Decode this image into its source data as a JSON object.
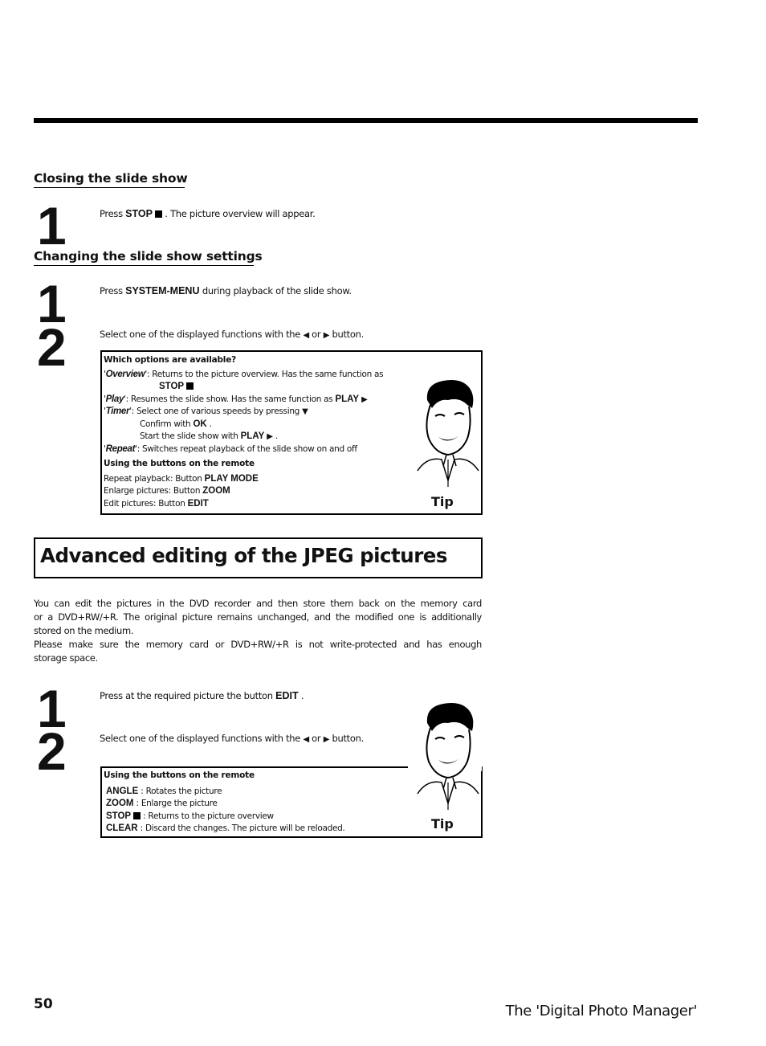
{
  "section1": {
    "title": "Closing the slide show",
    "step1": {
      "number": "1",
      "pre": "Press ",
      "key": "STOP",
      "post": " . The picture overview will appear."
    }
  },
  "section2": {
    "title": "Changing the slide show settings",
    "step1": {
      "number": "1",
      "pre": "Press ",
      "key": "SYSTEM-MENU",
      "post": " during playback of the slide show."
    },
    "step2": {
      "number": "2",
      "pre": "Select one of the displayed functions with the ",
      "mid": " or ",
      "post": " button."
    },
    "tipbox": {
      "heading": "Which options are available?",
      "overview_name": "Overview",
      "overview_text": ": Returns to the picture overview. Has the same function as",
      "overview_key": "STOP",
      "play_name": "Play",
      "play_text": ": Resumes the slide show. Has the same function as ",
      "play_key": "PLAY",
      "timer_name": "Timer",
      "timer_text": ": Select one of various speeds by pressing ",
      "confirm_pre": "Confirm with ",
      "confirm_key": "OK",
      "confirm_post": " .",
      "start_pre": "Start the slide show with ",
      "start_key": "PLAY",
      "start_post": " .",
      "repeat_name": "Repeat",
      "repeat_text": ": Switches repeat playback of the slide show on and off",
      "remote_heading": "Using the buttons on the remote",
      "remote_items": [
        {
          "label": "Repeat playback: Button ",
          "key": "PLAY MODE"
        },
        {
          "label": "Enlarge pictures: Button ",
          "key": "ZOOM"
        },
        {
          "label": "Edit pictures: Button ",
          "key": "EDIT"
        }
      ],
      "tip_label": "Tip"
    }
  },
  "section3": {
    "title": "Advanced editing of the JPEG pictures",
    "paragraphs": [
      [
        "You can edit the pictures in the DVD recorder and then store them back on the memory card",
        "or a DVD+RW/+R. The original picture remains unchanged, and the modified one is additionally",
        "stored on the medium."
      ],
      [
        "Please make sure the memory card or DVD+RW/+R is not write-protected and has enough",
        "storage space."
      ]
    ],
    "step1": {
      "number": "1",
      "pre": "Press at the required picture the button ",
      "key": "EDIT",
      "post": " ."
    },
    "step2": {
      "number": "2",
      "pre": "Select one of the displayed functions with the ",
      "mid": " or ",
      "post": " button."
    },
    "tipbox": {
      "heading": "Using the buttons on the remote",
      "items": [
        {
          "key": "ANGLE",
          "text": " : Rotates the picture"
        },
        {
          "key": "ZOOM",
          "text": " : Enlarge the picture"
        },
        {
          "key": "STOP",
          "text": " : Returns to the picture overview"
        },
        {
          "key": "CLEAR",
          "text": " : Discard the changes. The picture will be reloaded."
        }
      ],
      "tip_label": "Tip"
    }
  },
  "footer": {
    "page_number": "50",
    "chapter_title": "The 'Digital Photo Manager'"
  }
}
